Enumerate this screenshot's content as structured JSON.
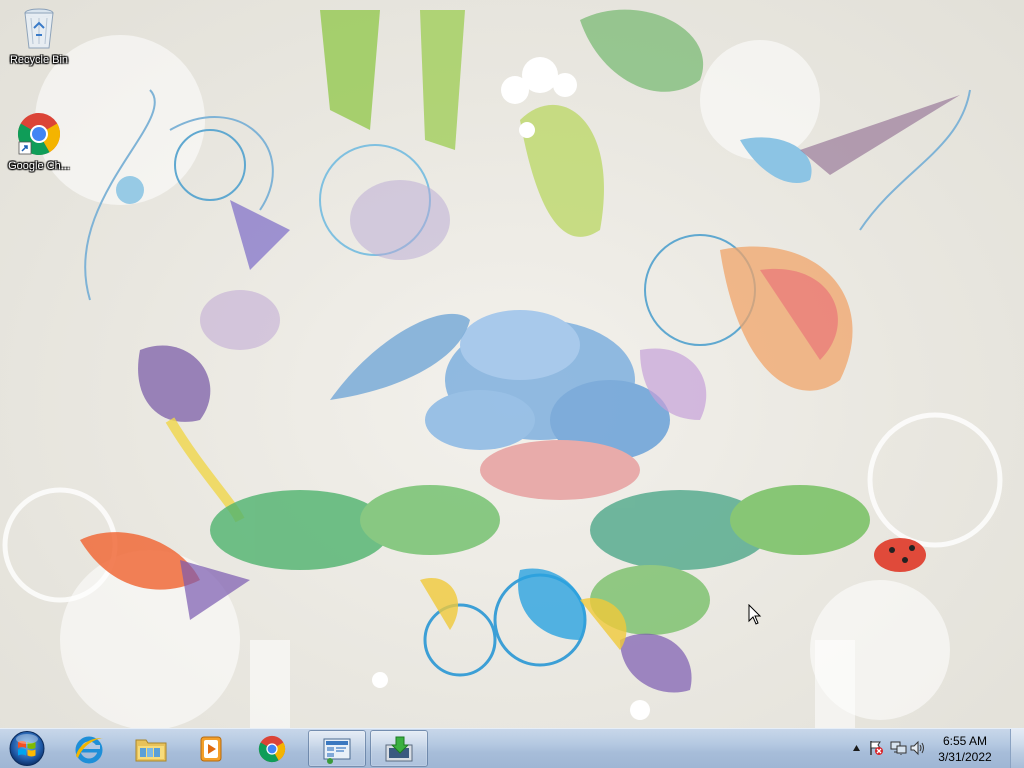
{
  "desktop": {
    "icons": [
      {
        "label": "Recycle Bin",
        "icon": "recycle-bin-icon"
      },
      {
        "label": "Google Ch...",
        "icon": "chrome-icon"
      }
    ]
  },
  "taskbar": {
    "start": {
      "icon": "windows-logo-icon"
    },
    "pinned": [
      {
        "icon": "internet-explorer-icon"
      },
      {
        "icon": "file-explorer-icon"
      },
      {
        "icon": "media-player-icon"
      },
      {
        "icon": "chrome-icon"
      },
      {
        "icon": "control-panel-icon"
      },
      {
        "icon": "installer-icon"
      }
    ]
  },
  "tray": {
    "icons": [
      "show-hidden-icons-arrow-icon",
      "action-center-flag-icon",
      "network-icon",
      "volume-icon"
    ],
    "time": "6:55 AM",
    "date": "3/31/2022"
  },
  "colors": {
    "taskbar": "#b4c8e1",
    "desktop": "#ece9e2"
  }
}
